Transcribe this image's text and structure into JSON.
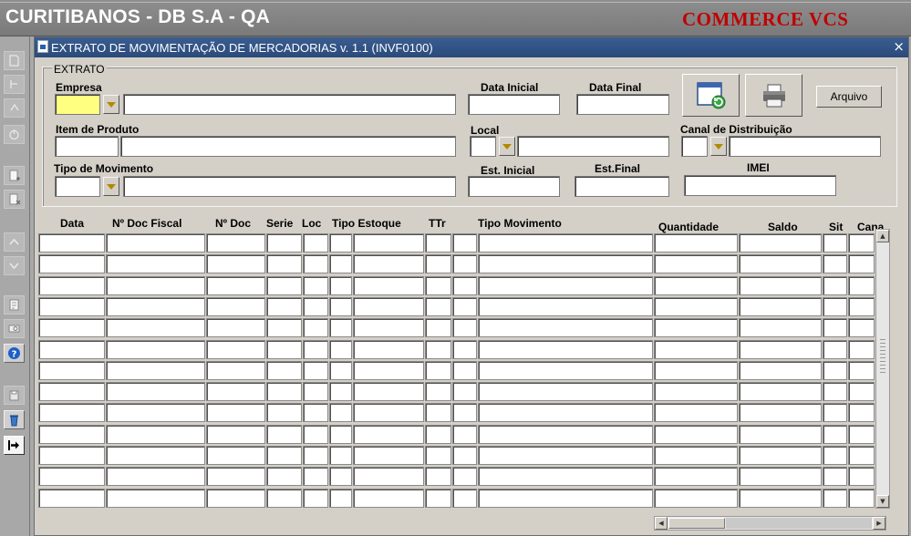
{
  "app": {
    "title": "CURITIBANOS - DB S.A - QA",
    "brand": "COMMERCE VCS"
  },
  "window": {
    "title": "EXTRATO DE MOVIMENTAÇÃO DE MERCADORIAS v. 1.1 (INVF0100)",
    "close": "×"
  },
  "form": {
    "section_title": "EXTRATO",
    "labels": {
      "empresa": "Empresa",
      "data_inicial": "Data Inicial",
      "data_final": "Data Final",
      "item_produto": "Item de Produto",
      "local": "Local",
      "canal": "Canal de Distribuição",
      "tipo_movimento": "Tipo de Movimento",
      "est_inicial": "Est. Inicial",
      "est_final": "Est.Final",
      "imei": "IMEI"
    },
    "values": {
      "empresa_code": "",
      "empresa_name": "",
      "data_inicial": "",
      "data_final": "",
      "item_code": "",
      "item_name": "",
      "local_code": "",
      "local_name": "",
      "canal_code": "",
      "canal_name": "",
      "tipo_code": "",
      "tipo_name": "",
      "est_inicial": "",
      "est_final": "",
      "imei": ""
    },
    "buttons": {
      "arquivo": "Arquivo"
    },
    "icons": {
      "refresh": "window-refresh-icon",
      "print": "printer-icon"
    }
  },
  "grid": {
    "columns": [
      "Data",
      "Nº Doc Fiscal",
      "Nº Doc",
      "Serie",
      "Loc",
      "Tipo Estoque",
      "TTr",
      "Tipo Movimento",
      "Quantidade",
      "Saldo",
      "Sit",
      "Cana"
    ],
    "row_count": 13
  },
  "toolbar": {
    "icons": [
      "save-icon",
      "undo-icon",
      "redo-icon",
      "exit-icon",
      "insert-record-icon",
      "delete-record-icon",
      "previous-icon",
      "next-icon",
      "edit-icon",
      "query-icon",
      "help-icon",
      "print-icon",
      "trash-icon",
      "exit-arrow-icon"
    ]
  }
}
